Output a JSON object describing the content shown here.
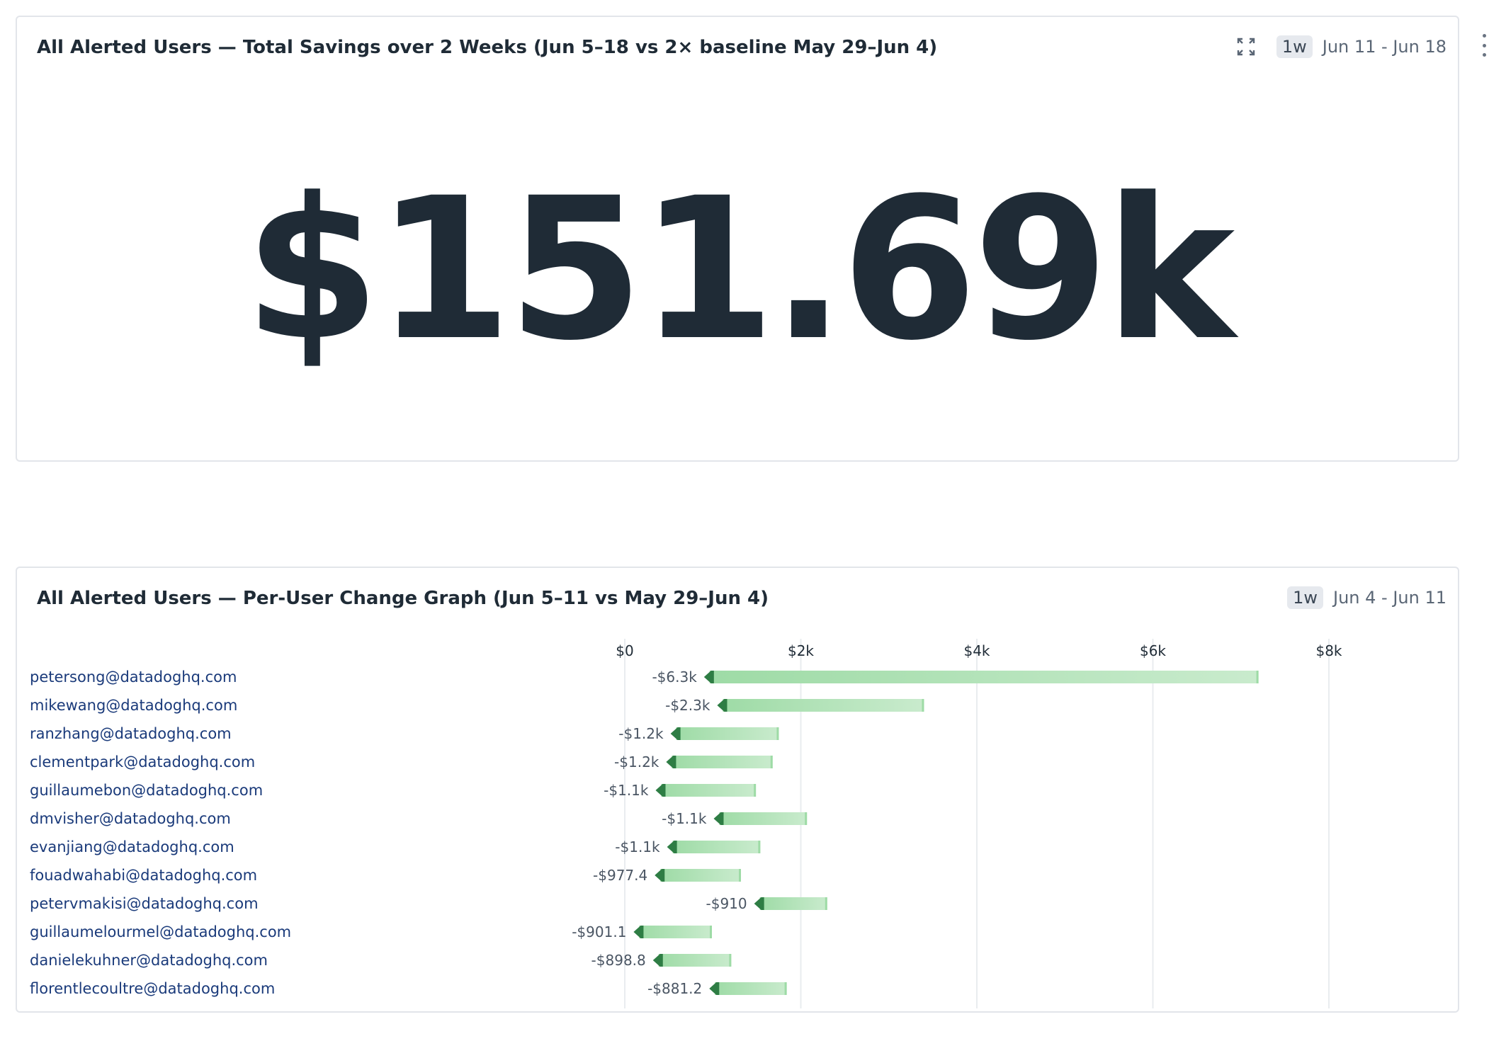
{
  "widget1": {
    "title": "All Alerted Users — Total Savings over 2 Weeks (Jun 5–18 vs 2× baseline May 29–Jun 4)",
    "timeframe_badge": "1w",
    "date_range": "Jun 11 - Jun 18",
    "value": "$151.69k"
  },
  "widget2": {
    "title": "All Alerted Users — Per-User Change Graph (Jun 5–11 vs May 29–Jun 4)",
    "timeframe_badge": "1w",
    "date_range": "Jun 4 - Jun 11"
  },
  "colors": {
    "bar_light": "#c9ebcd",
    "bar_mid": "#9edba6",
    "arrow": "#2e7d44",
    "grid": "#e9ecef"
  },
  "chart_data": {
    "type": "bar",
    "orientation": "horizontal",
    "chart_style": "change-graph",
    "x_axis_ticks": [
      "$0",
      "$2k",
      "$4k",
      "$6k",
      "$8k"
    ],
    "xlim": [
      0,
      8000
    ],
    "rows": [
      {
        "user": "petersong@datadoghq.com",
        "from": 7200,
        "to": 900,
        "label": "-$6.3k"
      },
      {
        "user": "mikewang@datadoghq.com",
        "from": 3400,
        "to": 1050,
        "label": "-$2.3k"
      },
      {
        "user": "ranzhang@datadoghq.com",
        "from": 1750,
        "to": 520,
        "label": "-$1.2k"
      },
      {
        "user": "clementpark@datadoghq.com",
        "from": 1680,
        "to": 470,
        "label": "-$1.2k"
      },
      {
        "user": "guillaumebon@datadoghq.com",
        "from": 1490,
        "to": 350,
        "label": "-$1.1k"
      },
      {
        "user": "dmvisher@datadoghq.com",
        "from": 2070,
        "to": 1010,
        "label": "-$1.1k"
      },
      {
        "user": "evanjiang@datadoghq.com",
        "from": 1540,
        "to": 480,
        "label": "-$1.1k"
      },
      {
        "user": "fouadwahabi@datadoghq.com",
        "from": 1320,
        "to": 340,
        "label": "-$977.4"
      },
      {
        "user": "petervmakisi@datadoghq.com",
        "from": 2300,
        "to": 1470,
        "label": "-$910"
      },
      {
        "user": "guillaumelourmel@datadoghq.com",
        "from": 990,
        "to": 100,
        "label": "-$901.1"
      },
      {
        "user": "danielekuhner@datadoghq.com",
        "from": 1210,
        "to": 320,
        "label": "-$898.8"
      },
      {
        "user": "florentlecoultre@datadoghq.com",
        "from": 1840,
        "to": 960,
        "label": "-$881.2"
      }
    ]
  }
}
